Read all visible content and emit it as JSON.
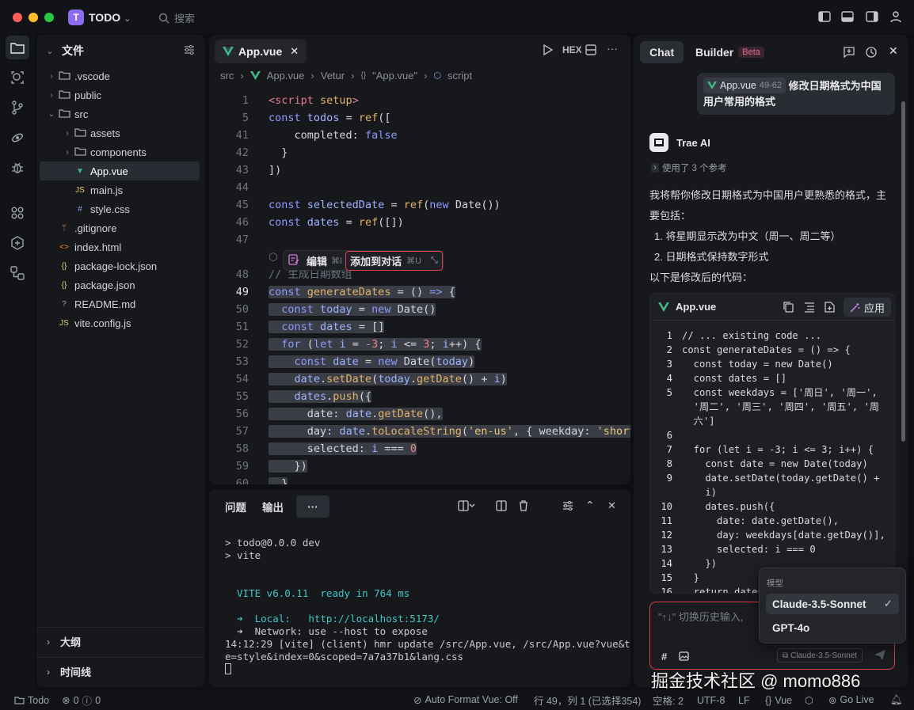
{
  "window": {
    "app_name": "TODO",
    "app_initial": "T",
    "search_placeholder": "搜索"
  },
  "explorer": {
    "title": "文件",
    "items": [
      {
        "label": ".vscode",
        "type": "folder",
        "depth": 0
      },
      {
        "label": "public",
        "type": "folder",
        "depth": 0
      },
      {
        "label": "src",
        "type": "folder-open",
        "depth": 0
      },
      {
        "label": "assets",
        "type": "folder",
        "depth": 1
      },
      {
        "label": "components",
        "type": "folder",
        "depth": 1
      },
      {
        "label": "App.vue",
        "type": "vue",
        "depth": 1,
        "selected": true
      },
      {
        "label": "main.js",
        "type": "js",
        "depth": 1
      },
      {
        "label": "style.css",
        "type": "css",
        "depth": 1
      },
      {
        "label": ".gitignore",
        "type": "git",
        "depth": 0
      },
      {
        "label": "index.html",
        "type": "html",
        "depth": 0
      },
      {
        "label": "package-lock.json",
        "type": "json",
        "depth": 0
      },
      {
        "label": "package.json",
        "type": "json",
        "depth": 0
      },
      {
        "label": "README.md",
        "type": "md",
        "depth": 0
      },
      {
        "label": "vite.config.js",
        "type": "js",
        "depth": 0
      }
    ],
    "outline": "大纲",
    "timeline": "时间线"
  },
  "editor": {
    "tab": "App.vue",
    "hex": "HEX",
    "breadcrumb": [
      "src",
      "App.vue",
      "Vetur",
      "\"App.vue\"",
      "script"
    ],
    "line_numbers": [
      "1",
      "5",
      "41",
      "42",
      "43",
      "44",
      "45",
      "46",
      "47",
      "",
      "48",
      "49",
      "50",
      "51",
      "52",
      "53",
      "54",
      "55",
      "56",
      "57",
      "58",
      "59",
      "60"
    ],
    "inline_actions": {
      "edit": "编辑",
      "edit_key": "⌘I",
      "add": "添加到对话",
      "add_key": "⌘U"
    }
  },
  "terminal": {
    "tabs": [
      "问题",
      "输出",
      "···"
    ],
    "lines": [
      "> todo@0.0.0 dev",
      "> vite",
      "",
      "",
      "  VITE v6.0.11  ready in 764 ms",
      "",
      "  ➜  Local:   http://localhost:5173/",
      "  ➜  Network: use --host to expose",
      "14:12:29 [vite] (client) hmr update /src/App.vue, /src/App.vue?vue&typ",
      "e=style&index=0&scoped=7a7a37b1&lang.css"
    ]
  },
  "chat": {
    "tabs": [
      "Chat",
      "Builder"
    ],
    "beta": "Beta",
    "user_message": {
      "chip_file": "App.vue",
      "chip_range": "49-62",
      "text": "修改日期格式为中国用户常用的格式"
    },
    "ai_name": "Trae AI",
    "refs": "使用了 3 个参考",
    "ai_intro": "我将帮你修改日期格式为中国用户更熟悉的格式，主要包括：",
    "ai_points": [
      "1. 将星期显示改为中文（周一、周二等）",
      "2. 日期格式保持数字形式"
    ],
    "ai_after": "以下是修改后的代码：",
    "code_card": {
      "file": "App.vue",
      "apply": "应用",
      "lines": [
        {
          "n": "1",
          "t": "// ... existing code ..."
        },
        {
          "n": "2",
          "t": "const generateDates = () => {"
        },
        {
          "n": "3",
          "t": "  const today = new Date()"
        },
        {
          "n": "4",
          "t": "  const dates = []"
        },
        {
          "n": "5",
          "t": "  const weekdays = ['周日', '周一',"
        },
        {
          "n": "",
          "t": "  '周二', '周三', '周四', '周五', '周"
        },
        {
          "n": "",
          "t": "  六']"
        },
        {
          "n": "6",
          "t": ""
        },
        {
          "n": "7",
          "t": "  for (let i = -3; i <= 3; i++) {"
        },
        {
          "n": "8",
          "t": "    const date = new Date(today)"
        },
        {
          "n": "9",
          "t": "    date.setDate(today.getDate() +"
        },
        {
          "n": "",
          "t": "    i)"
        },
        {
          "n": "10",
          "t": "    dates.push({"
        },
        {
          "n": "11",
          "t": "      date: date.getDate(),"
        },
        {
          "n": "12",
          "t": "      day: weekdays[date.getDay()],"
        },
        {
          "n": "13",
          "t": "      selected: i === 0"
        },
        {
          "n": "14",
          "t": "    })"
        },
        {
          "n": "15",
          "t": "  }"
        },
        {
          "n": "16",
          "t": "  return dates"
        }
      ]
    },
    "input_placeholder": "\"↑↓\" 切换历史输入,",
    "model_chip": "Claude-3.5-Sonnet",
    "model_menu": {
      "title": "模型",
      "options": [
        "Claude-3.5-Sonnet",
        "GPT-4o"
      ],
      "selected": "Claude-3.5-Sonnet"
    }
  },
  "statusbar": {
    "project": "Todo",
    "errors": "0",
    "warnings": "0",
    "format": "Auto Format Vue: Off",
    "position": "行 49，列 1 (已选择354)",
    "spaces": "空格: 2",
    "encoding": "UTF-8",
    "eol": "LF",
    "lang": "Vue",
    "golive": "Go Live"
  },
  "watermark": "掘金技术社区 @ momo886",
  "colors": {
    "accent": "#8b6cf0",
    "highlight_border": "#e0404c",
    "vue_green": "#42b883"
  }
}
